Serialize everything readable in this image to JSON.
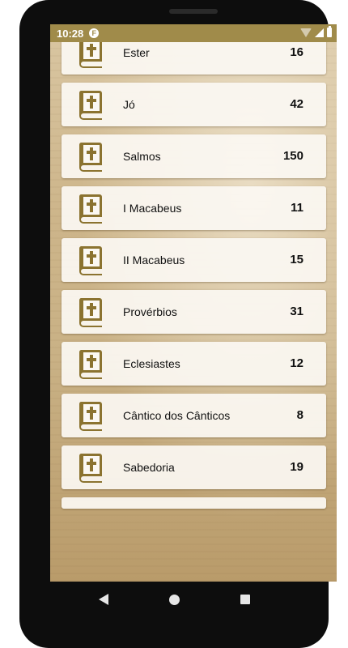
{
  "status_bar": {
    "time": "10:28",
    "app_badge": "F"
  },
  "icon_color": "#8b7330",
  "books": [
    {
      "name": "Ester",
      "chapters": "16"
    },
    {
      "name": "Jó",
      "chapters": "42"
    },
    {
      "name": "Salmos",
      "chapters": "150"
    },
    {
      "name": "I Macabeus",
      "chapters": "11"
    },
    {
      "name": "II Macabeus",
      "chapters": "15"
    },
    {
      "name": "Provérbios",
      "chapters": "31"
    },
    {
      "name": "Eclesiastes",
      "chapters": "12"
    },
    {
      "name": "Cântico dos Cânticos",
      "chapters": "8"
    },
    {
      "name": "Sabedoria",
      "chapters": "19"
    }
  ]
}
